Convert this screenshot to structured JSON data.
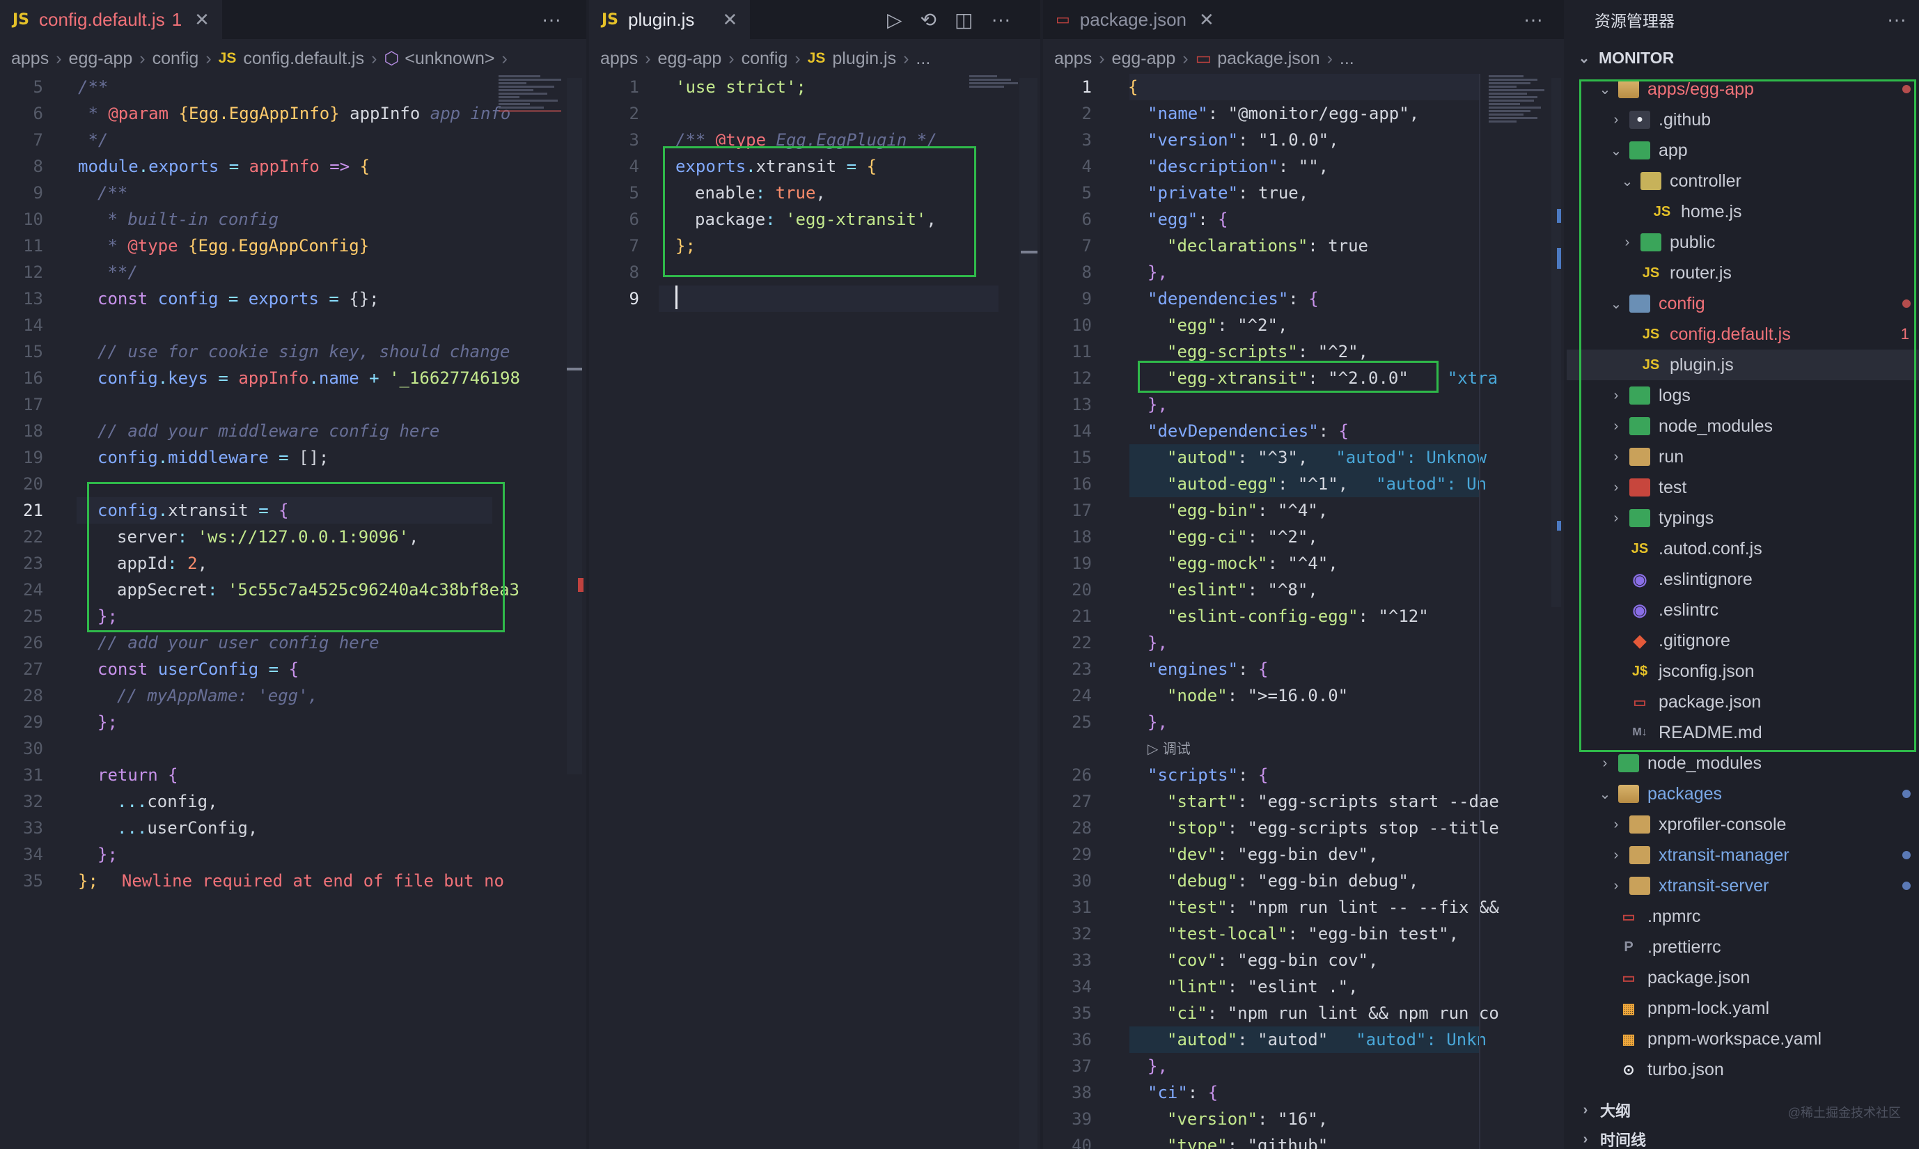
{
  "pane1": {
    "tab": {
      "label": "config.default.js",
      "badge": "1",
      "icon": "JS"
    },
    "more": "···",
    "breadcrumb": [
      "apps",
      "egg-app",
      "config",
      "config.default.js",
      "<unknown>"
    ],
    "lines": [
      {
        "n": "5"
      },
      {
        "n": "6"
      },
      {
        "n": "7"
      },
      {
        "n": "8"
      },
      {
        "n": "9"
      },
      {
        "n": "10"
      },
      {
        "n": "11"
      },
      {
        "n": "12"
      },
      {
        "n": "13"
      },
      {
        "n": "14"
      },
      {
        "n": "15"
      },
      {
        "n": "16"
      },
      {
        "n": "17"
      },
      {
        "n": "18"
      },
      {
        "n": "19"
      },
      {
        "n": "20"
      },
      {
        "n": "21"
      },
      {
        "n": "22"
      },
      {
        "n": "23"
      },
      {
        "n": "24"
      },
      {
        "n": "25"
      },
      {
        "n": "26"
      },
      {
        "n": "27"
      },
      {
        "n": "28"
      },
      {
        "n": "29"
      },
      {
        "n": "30"
      },
      {
        "n": "31"
      },
      {
        "n": "32"
      },
      {
        "n": "33"
      },
      {
        "n": "34"
      },
      {
        "n": "35"
      }
    ],
    "code": {
      "l5": "/**",
      "l6a": " * ",
      "l6b": "@param",
      "l6c": " {Egg.EggAppInfo}",
      "l6d": " appInfo",
      "l6e": " app info",
      "l7": " */",
      "l8a": "module",
      "l8b": ".",
      "l8c": "exports",
      "l8d": " = ",
      "l8e": "appInfo",
      "l8f": " => ",
      "l8g": "{",
      "l9": "/**",
      "l10": " * built-in config",
      "l11a": " * ",
      "l11b": "@type",
      "l11c": " {Egg.EggAppConfig}",
      "l12": " **/",
      "l13a": "const ",
      "l13b": "config",
      "l13c": " = ",
      "l13d": "exports",
      "l13e": " = ",
      "l13f": "{};",
      "l15": "// use for cookie sign key, should change",
      "l16a": "config",
      "l16b": ".",
      "l16c": "keys",
      "l16d": " = ",
      "l16e": "appInfo",
      "l16f": ".",
      "l16g": "name",
      "l16h": " + ",
      "l16i": "'_16627746198",
      "l18": "// add your middleware config here",
      "l19a": "config",
      "l19b": ".",
      "l19c": "middleware",
      "l19d": " = ",
      "l19e": "[];",
      "l21a": "config",
      "l21b": ".",
      "l21c": "xtransit",
      "l21d": " = ",
      "l21e": "{",
      "l22a": "server",
      "l22b": ": ",
      "l22c": "'ws://127.0.0.1:9096'",
      "l22d": ",",
      "l23a": "appId",
      "l23b": ": ",
      "l23c": "2",
      "l23d": ",",
      "l24a": "appSecret",
      "l24b": ": ",
      "l24c": "'5c55c7a4525c96240a4c38bf8ea3",
      "l25": "};",
      "l26": "// add your user config here",
      "l27a": "const ",
      "l27b": "userConfig",
      "l27c": " = ",
      "l27d": "{",
      "l28": "// myAppName: 'egg',",
      "l29": "};",
      "l31a": "return ",
      "l31b": "{",
      "l32a": "...",
      "l32b": "config",
      "l32c": ",",
      "l33a": "...",
      "l33b": "userConfig",
      "l33c": ",",
      "l34": "};",
      "l35a": "};",
      "l35b": "Newline required at end of file but no"
    }
  },
  "pane2": {
    "tab": {
      "label": "plugin.js",
      "icon": "JS"
    },
    "breadcrumb": [
      "apps",
      "egg-app",
      "config",
      "plugin.js",
      "..."
    ],
    "code": {
      "l1": "'use strict';",
      "l3a": "/** ",
      "l3b": "@type",
      "l3c": " Egg.EggPlugin */",
      "l4a": "exports",
      "l4b": ".",
      "l4c": "xtransit",
      "l4d": " = ",
      "l4e": "{",
      "l5a": "enable",
      "l5b": ": ",
      "l5c": "true",
      "l5d": ",",
      "l6a": "package",
      "l6b": ": ",
      "l6c": "'egg-xtransit'",
      "l6d": ",",
      "l7": "};"
    },
    "linenums": [
      "1",
      "2",
      "3",
      "4",
      "5",
      "6",
      "7",
      "8",
      "9"
    ]
  },
  "pane3": {
    "tab": {
      "label": "package.json"
    },
    "breadcrumb": [
      "apps",
      "egg-app",
      "package.json",
      "..."
    ],
    "linenums": [
      "1",
      "2",
      "3",
      "4",
      "5",
      "6",
      "7",
      "8",
      "9",
      "10",
      "11",
      "12",
      "13",
      "14",
      "15",
      "16",
      "17",
      "18",
      "19",
      "20",
      "21",
      "22",
      "23",
      "24",
      "25",
      "26",
      "27",
      "28",
      "29",
      "30",
      "31",
      "32",
      "33",
      "34",
      "35",
      "36",
      "37",
      "38",
      "39",
      "40"
    ],
    "debug_label": "▷ 调试",
    "code": {
      "l1": "{",
      "l2a": "\"name\"",
      "l2b": ": ",
      "l2c": "\"@monitor/egg-app\"",
      "l2d": ",",
      "l3a": "\"version\"",
      "l3b": ": ",
      "l3c": "\"1.0.0\"",
      "l3d": ",",
      "l4a": "\"description\"",
      "l4b": ": ",
      "l4c": "\"\"",
      "l4d": ",",
      "l5a": "\"private\"",
      "l5b": ": ",
      "l5c": "true",
      "l5d": ",",
      "l6a": "\"egg\"",
      "l6b": ": ",
      "l6c": "{",
      "l7a": "\"declarations\"",
      "l7b": ": ",
      "l7c": "true",
      "l8": "},",
      "l9a": "\"dependencies\"",
      "l9b": ": ",
      "l9c": "{",
      "l10a": "\"egg\"",
      "l10b": ": ",
      "l10c": "\"^2\"",
      "l10d": ",",
      "l11a": "\"egg-scripts\"",
      "l11b": ": ",
      "l11c": "\"^2\"",
      "l11d": ",",
      "l12a": "\"egg-xtransit\"",
      "l12b": ": ",
      "l12c": "\"^2.0.0\"",
      "l12d": "\"xtra",
      "l13": "},",
      "l14a": "\"devDependencies\"",
      "l14b": ": ",
      "l14c": "{",
      "l15a": "\"autod\"",
      "l15b": ": ",
      "l15c": "\"^3\"",
      "l15d": ",",
      "l15e": "\"autod\": Unknow",
      "l16a": "\"autod-egg\"",
      "l16b": ": ",
      "l16c": "\"^1\"",
      "l16d": ",",
      "l16e": "\"autod\": Un",
      "l17a": "\"egg-bin\"",
      "l17b": ": ",
      "l17c": "\"^4\"",
      "l17d": ",",
      "l18a": "\"egg-ci\"",
      "l18b": ": ",
      "l18c": "\"^2\"",
      "l18d": ",",
      "l19a": "\"egg-mock\"",
      "l19b": ": ",
      "l19c": "\"^4\"",
      "l19d": ",",
      "l20a": "\"eslint\"",
      "l20b": ": ",
      "l20c": "\"^8\"",
      "l20d": ",",
      "l21a": "\"eslint-config-egg\"",
      "l21b": ": ",
      "l21c": "\"^12\"",
      "l22": "},",
      "l23a": "\"engines\"",
      "l23b": ": ",
      "l23c": "{",
      "l24a": "\"node\"",
      "l24b": ": ",
      "l24c": "\">=16.0.0\"",
      "l25": "},",
      "l26a": "\"scripts\"",
      "l26b": ": ",
      "l26c": "{",
      "l27a": "\"start\"",
      "l27b": ": ",
      "l27c": "\"egg-scripts start --dae",
      "l28a": "\"stop\"",
      "l28b": ": ",
      "l28c": "\"egg-scripts stop --title",
      "l29a": "\"dev\"",
      "l29b": ": ",
      "l29c": "\"egg-bin dev\"",
      "l29d": ",",
      "l30a": "\"debug\"",
      "l30b": ": ",
      "l30c": "\"egg-bin debug\"",
      "l30d": ",",
      "l31a": "\"test\"",
      "l31b": ": ",
      "l31c": "\"npm run lint -- --fix &&",
      "l32a": "\"test-local\"",
      "l32b": ": ",
      "l32c": "\"egg-bin test\"",
      "l32d": ",",
      "l33a": "\"cov\"",
      "l33b": ": ",
      "l33c": "\"egg-bin cov\"",
      "l33d": ",",
      "l34a": "\"lint\"",
      "l34b": ": ",
      "l34c": "\"eslint .\"",
      "l34d": ",",
      "l35a": "\"ci\"",
      "l35b": ": ",
      "l35c": "\"npm run lint && npm run co",
      "l36a": "\"autod\"",
      "l36b": ": ",
      "l36c": "\"autod\"",
      "l36d": "\"autod\": Unkn",
      "l37": "},",
      "l38a": "\"ci\"",
      "l38b": ": ",
      "l38c": "{",
      "l39a": "\"version\"",
      "l39b": ": ",
      "l39c": "\"16\"",
      "l39d": ",",
      "l40a": "\"type\"",
      "l40b": ": ",
      "l40c": "\"github\""
    }
  },
  "explorer": {
    "title": "资源管理器",
    "section": "MONITOR",
    "items": [
      {
        "label": "apps/egg-app"
      },
      {
        "label": ".github"
      },
      {
        "label": "app"
      },
      {
        "label": "controller"
      },
      {
        "label": "home.js"
      },
      {
        "label": "public"
      },
      {
        "label": "router.js"
      },
      {
        "label": "config"
      },
      {
        "label": "config.default.js",
        "badge": "1"
      },
      {
        "label": "plugin.js"
      },
      {
        "label": "logs"
      },
      {
        "label": "node_modules"
      },
      {
        "label": "run"
      },
      {
        "label": "test"
      },
      {
        "label": "typings"
      },
      {
        "label": ".autod.conf.js"
      },
      {
        "label": ".eslintignore"
      },
      {
        "label": ".eslintrc"
      },
      {
        "label": ".gitignore"
      },
      {
        "label": "jsconfig.json"
      },
      {
        "label": "package.json"
      },
      {
        "label": "README.md"
      },
      {
        "label": "node_modules"
      },
      {
        "label": "packages"
      },
      {
        "label": "xprofiler-console"
      },
      {
        "label": "xtransit-manager"
      },
      {
        "label": "xtransit-server"
      },
      {
        "label": ".npmrc"
      },
      {
        "label": ".prettierrc"
      },
      {
        "label": "package.json"
      },
      {
        "label": "pnpm-lock.yaml"
      },
      {
        "label": "pnpm-workspace.yaml"
      },
      {
        "label": "turbo.json"
      }
    ],
    "outline": "大纲",
    "timeline": "时间线",
    "watermark": "@稀土掘金技术社区"
  },
  "colors": {
    "accent_green": "#2fb94a",
    "error": "#f07178",
    "blue": "#7aa8e6"
  }
}
